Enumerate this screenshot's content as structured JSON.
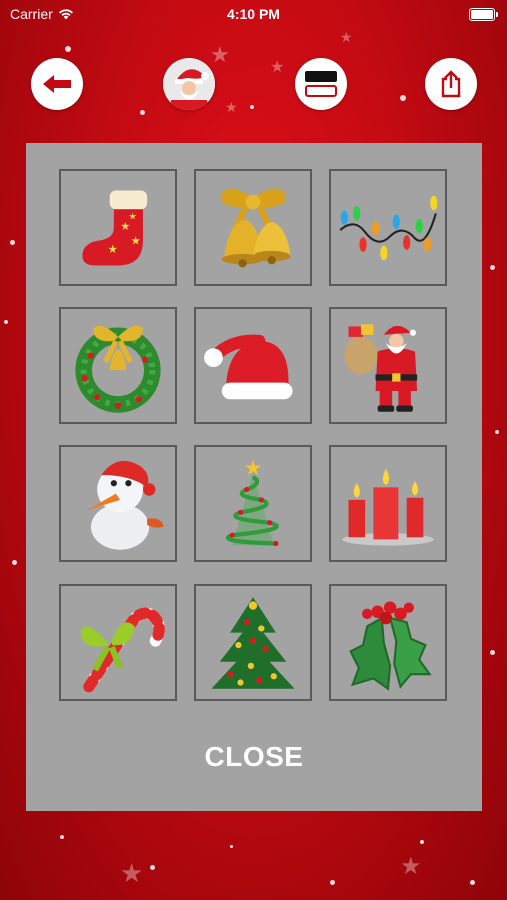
{
  "status_bar": {
    "carrier": "Carrier",
    "time": "4:10 PM"
  },
  "toolbar": {
    "back_icon": "arrow-left-icon",
    "santa_icon": "santa-avatar-icon",
    "frame_icon": "frame-toggle-icon",
    "share_icon": "share-icon"
  },
  "sticker_panel": {
    "stickers": [
      {
        "name": "stocking"
      },
      {
        "name": "bells"
      },
      {
        "name": "string-lights"
      },
      {
        "name": "wreath"
      },
      {
        "name": "santa-hat"
      },
      {
        "name": "santa-claus"
      },
      {
        "name": "snowman"
      },
      {
        "name": "swirl-tree"
      },
      {
        "name": "candles"
      },
      {
        "name": "candy-cane"
      },
      {
        "name": "christmas-tree"
      },
      {
        "name": "holly"
      }
    ],
    "close_label": "CLOSE"
  },
  "colors": {
    "background": "#c30a12",
    "panel": "#a3a3a3",
    "cell_border": "#5a5a5a"
  }
}
